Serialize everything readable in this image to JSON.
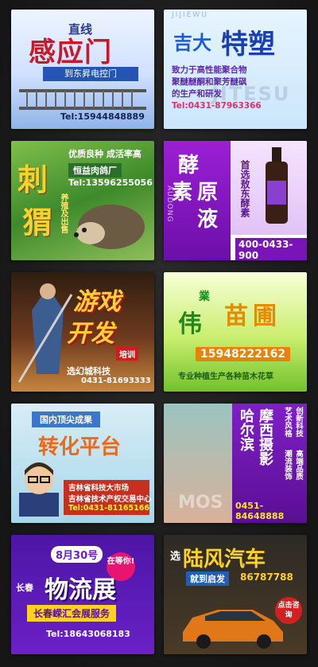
{
  "tiles": {
    "gate": {
      "heading": "直线",
      "title": "感应门",
      "banner": "到东昇电控门",
      "phone": "Tel:15944848889"
    },
    "plastic": {
      "watermark_top": "JIJIEWU",
      "title_small": "吉大",
      "title_large": "特塑",
      "lines": [
        "致力于高性能聚合物",
        "聚醚醚酮和聚芳醚砜",
        "的生产和研发"
      ],
      "phone": "Tel:0431-87963366",
      "watermark_bottom": "JITESU"
    },
    "hedgehog": {
      "char1": "刺",
      "char2": "猬",
      "slogan": "优质良种 成活率高",
      "farm": "恒益肉鸽厂",
      "phone": "Tel:13596255056",
      "vertical": "养殖及出售"
    },
    "enzyme": {
      "char1": "酵",
      "char2": "素",
      "char3": "原",
      "char4": "液",
      "vertical": "首选敖东酵素",
      "brand_en": "AUDONG",
      "phone": "400-0433-900"
    },
    "game": {
      "title1": "游戏",
      "title2": "开发",
      "tag": "培训",
      "company": "选幻城科技",
      "phone": "0431-81693333"
    },
    "nursery": {
      "char1": "伟",
      "char2": "業",
      "char3": "苗",
      "char4": "圃",
      "phone": "15948222162",
      "desc": "专业种植生产各种苗木花草"
    },
    "tech": {
      "ribbon": "国内顶尖成果",
      "title": "转化平台",
      "line1": "吉林省科技大市场",
      "line2": "吉林省技术产权交易中心",
      "phone": "Tel:0431-81165166"
    },
    "photo": {
      "v1": "哈尔滨",
      "v2": "摩西摄影",
      "v3": "创新科技",
      "v4": "艺术风格",
      "v5": "高端品质",
      "v6": "潮流装饰",
      "phone": "0451-84648888",
      "watermark": "MOS"
    },
    "logistics": {
      "date": "8月30号",
      "wait": "在等你!",
      "city": "长春",
      "title": "物流展",
      "band": "长春嵘汇会展服务",
      "phone": "Tel:18643068183"
    },
    "car": {
      "pick": "选",
      "title": "陆风汽车",
      "soon": "就到启发",
      "phone": "86787788",
      "cta": "点击咨询"
    }
  }
}
